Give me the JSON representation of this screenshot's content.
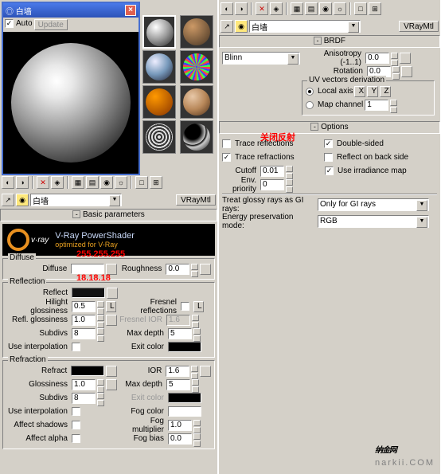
{
  "window": {
    "title": "白墙",
    "auto": "Auto",
    "update": "Update"
  },
  "slot": {
    "label": "白墙",
    "type": "VRayMtl"
  },
  "basic": {
    "heading": "Basic parameters",
    "shader_title": "V-Ray PowerShader",
    "shader_sub": "optimized for V-Ray"
  },
  "diffuse": {
    "heading": "Diffuse",
    "annot": "255.255.255",
    "diffuse": "Diffuse",
    "roughness": "Roughness",
    "roughness_v": "0.0"
  },
  "reflection": {
    "heading": "Reflection",
    "annot": "18.18.18",
    "reflect": "Reflect",
    "hilight": "Hilight glossiness",
    "hilight_v": "0.5",
    "refl": "Refl. glossiness",
    "refl_v": "1.0",
    "subdivs": "Subdivs",
    "subdivs_v": "8",
    "useint": "Use interpolation",
    "fresnel": "Fresnel reflections",
    "fior": "Fresnel IOR",
    "fior_v": "1.6",
    "maxd": "Max depth",
    "maxd_v": "5",
    "exitc": "Exit color",
    "L": "L"
  },
  "refraction": {
    "heading": "Refraction",
    "refract": "Refract",
    "gloss": "Glossiness",
    "gloss_v": "1.0",
    "subdivs": "Subdivs",
    "subdivs_v": "8",
    "useint": "Use interpolation",
    "shadows": "Affect shadows",
    "alpha": "Affect alpha",
    "ior": "IOR",
    "ior_v": "1.6",
    "maxd": "Max depth",
    "maxd_v": "5",
    "exitc": "Exit color",
    "fogc": "Fog color",
    "fogm": "Fog multiplier",
    "fogm_v": "1.0",
    "fogb": "Fog bias",
    "fogb_v": "0.0"
  },
  "brdf": {
    "heading": "BRDF",
    "type": "Blinn",
    "aniso": "Anisotropy (-1..1)",
    "aniso_v": "0.0",
    "rot": "Rotation",
    "rot_v": "0.0",
    "uv": "UV vectors derivation",
    "local": "Local axis",
    "x": "X",
    "y": "Y",
    "z": "Z",
    "mapch": "Map channel",
    "mapch_v": "1"
  },
  "options": {
    "heading": "Options",
    "annot": "关闭反射",
    "trefl": "Trace reflections",
    "trefr": "Trace refractions",
    "cutoff": "Cutoff",
    "cutoff_v": "0.01",
    "envp": "Env. priority",
    "envp_v": "0",
    "dsided": "Double-sided",
    "rback": "Reflect on back side",
    "irrad": "Use irradiance map",
    "glossy": "Treat glossy rays as GI rays:",
    "glossy_v": "Only for GI rays",
    "energy": "Energy preservation mode:",
    "energy_v": "RGB"
  },
  "watermark": {
    "cn": "纳金网",
    "en": "narkii.COM"
  }
}
